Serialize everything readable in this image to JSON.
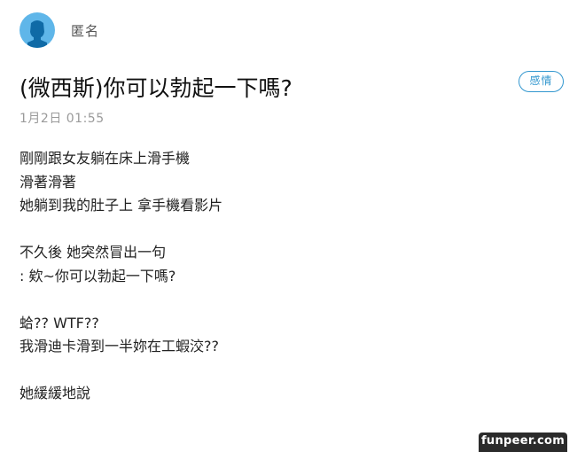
{
  "author": {
    "name": "匿名",
    "avatar_icon": "anonymous-avatar-icon",
    "avatar_color": "#5fb6e9"
  },
  "post": {
    "title": "(微西斯)你可以勃起一下嗎?",
    "category": "感情",
    "date": "1月2日 01:55",
    "body_lines": [
      "剛剛跟女友躺在床上滑手機",
      "滑著滑著",
      "她躺到我的肚子上 拿手機看影片",
      "",
      "不久後 她突然冒出一句",
      ": 欸~你可以勃起一下嗎?",
      "",
      "蛤?? WTF??",
      "我滑迪卡滑到一半妳在工蝦洨??",
      "",
      "她緩緩地說"
    ]
  },
  "watermark": "funpeer.com",
  "colors": {
    "accent": "#3397cf",
    "date_gray": "#9a9a9a",
    "watermark_bg": "#2b2b2b"
  }
}
